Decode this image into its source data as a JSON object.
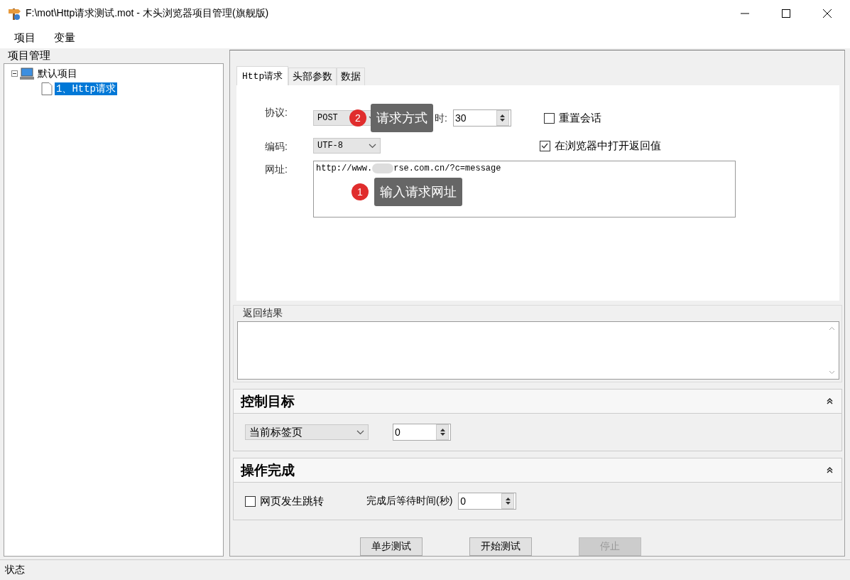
{
  "window": {
    "title": "F:\\mot\\Http请求测试.mot  - 木头浏览器项目管理(旗舰版)"
  },
  "menu": [
    "项目",
    "变量"
  ],
  "sidebar": {
    "title": "项目管理",
    "tree": [
      {
        "label": "默认项目",
        "expanded": true,
        "selected": false,
        "children": [
          {
            "label": "1、Http请求",
            "selected": true
          }
        ]
      }
    ]
  },
  "tabs": [
    {
      "label": "Http请求",
      "selected": true
    },
    {
      "label": "头部参数",
      "selected": false
    },
    {
      "label": "数据",
      "selected": false
    }
  ],
  "form": {
    "protocol_label": "协议:",
    "protocol": "POST",
    "timeout_label": "时:",
    "timeout": "30",
    "encoding_label": "编码:",
    "encoding": "UTF-8",
    "url_label": "网址:",
    "url_start": "http://www.",
    "url_end": "rse.com.cn/?c=message",
    "options": [
      {
        "label": "重置会话",
        "checked": false
      },
      {
        "label": "在浏览器中打开返回值",
        "checked": true
      }
    ]
  },
  "annotations": [
    {
      "number": "2",
      "text": "请求方式"
    },
    {
      "number": "1",
      "text": "输入请求网址"
    }
  ],
  "result": {
    "title": "返回结果"
  },
  "control_target": {
    "title": "控制目标",
    "expanded": true,
    "target": "当前标签页",
    "index": "0"
  },
  "on_complete": {
    "title": "操作完成",
    "expanded": true,
    "redirect_label": "网页发生跳转",
    "redirect": false,
    "wait_label": "完成后等待时间(秒)",
    "wait": "0"
  },
  "buttons": [
    {
      "label": "单步测试",
      "disabled": false
    },
    {
      "label": "开始测试",
      "disabled": false
    },
    {
      "label": "停止",
      "disabled": true
    }
  ],
  "status_bar": "状态"
}
